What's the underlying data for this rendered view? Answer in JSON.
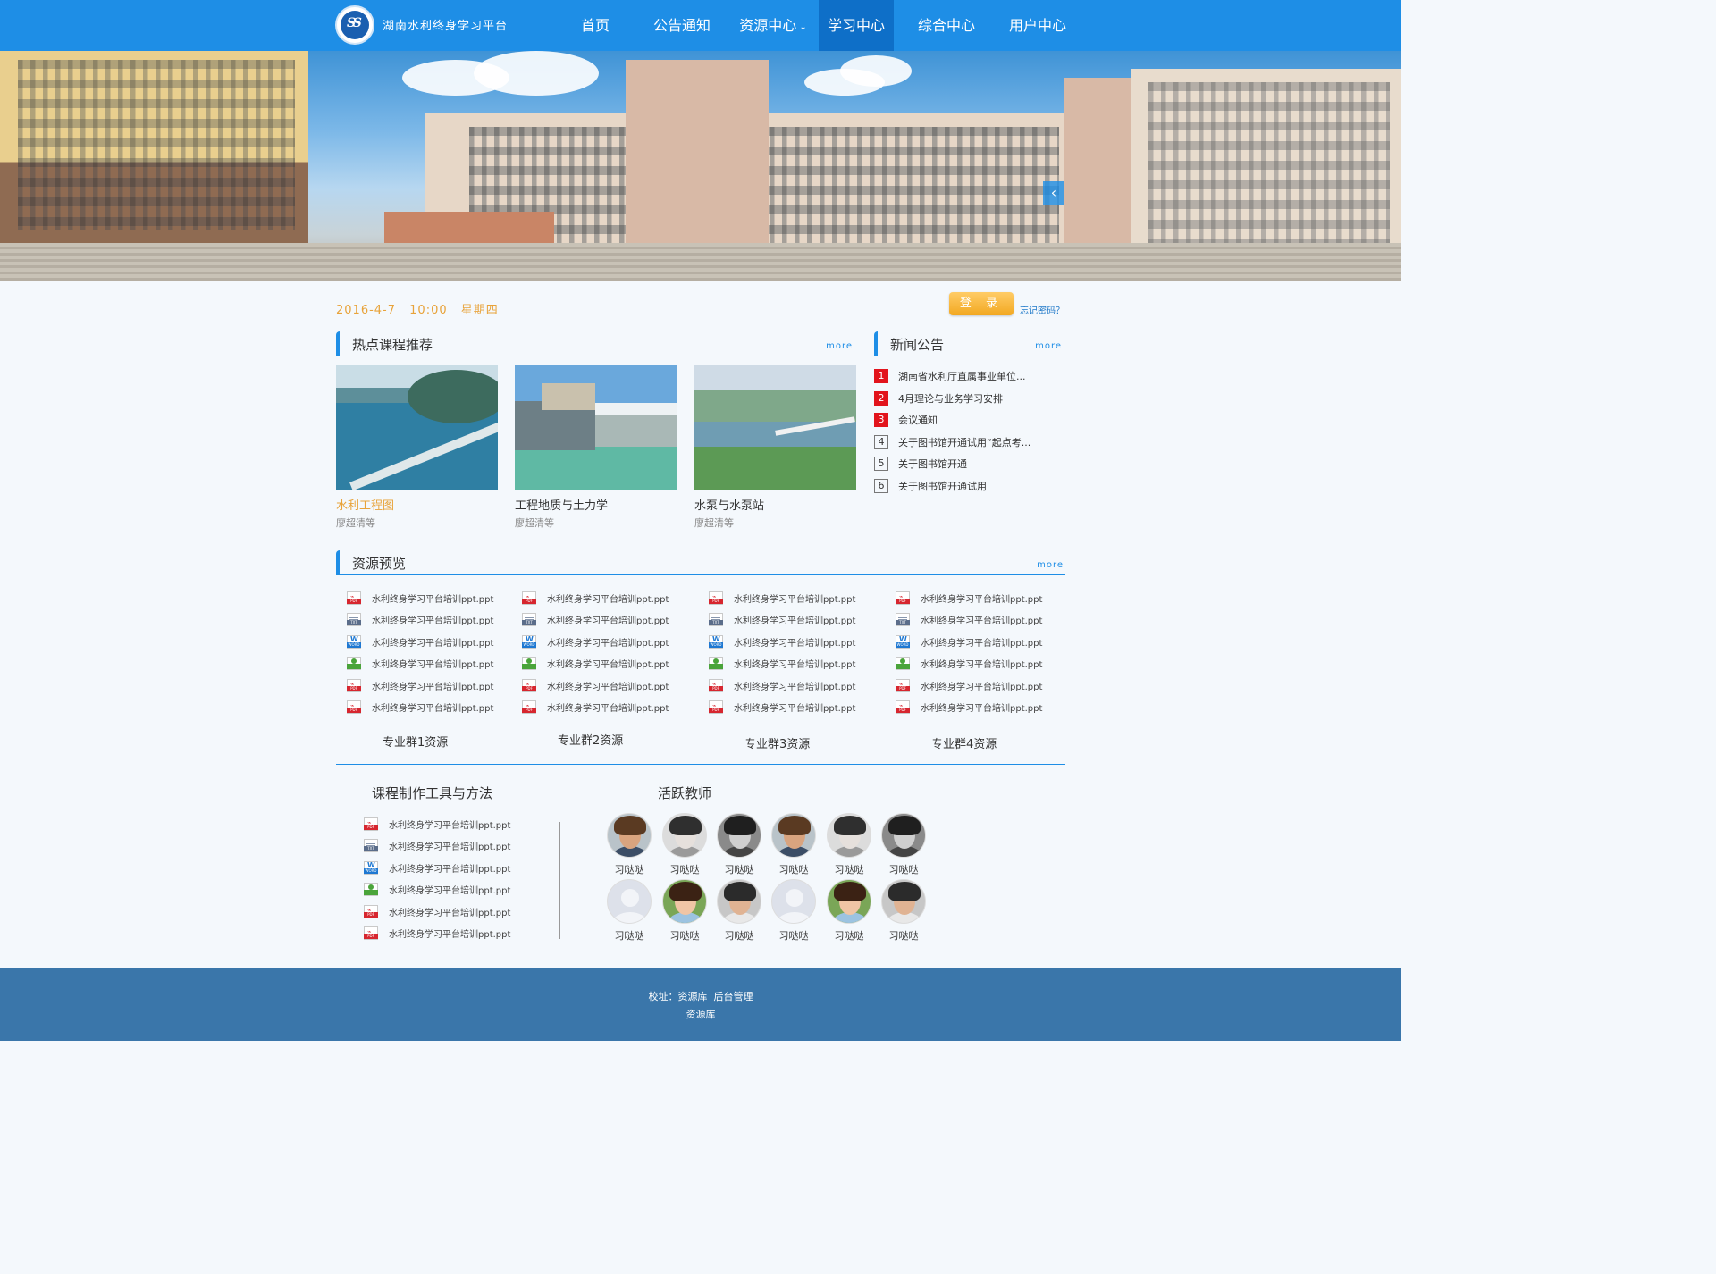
{
  "header": {
    "site_title": "湖南水利终身学习平台",
    "logo_glyph": "SS",
    "nav": [
      {
        "label": "首页",
        "active": false,
        "dropdown": false
      },
      {
        "label": "公告通知",
        "active": false,
        "dropdown": false
      },
      {
        "label": "资源中心",
        "active": false,
        "dropdown": true
      },
      {
        "label": "学习中心",
        "active": true,
        "dropdown": false
      },
      {
        "label": "综合中心",
        "active": false,
        "dropdown": false
      },
      {
        "label": "用户中心",
        "active": false,
        "dropdown": false
      }
    ]
  },
  "banner": {
    "arrow_glyph": "‹"
  },
  "info_bar": {
    "date": "2016-4-7",
    "time": "10:00",
    "weekday": "星期四",
    "login_label": "登 录",
    "forgot_label": "忘记密码？"
  },
  "hot_courses": {
    "title": "热点课程推荐",
    "more": "more",
    "items": [
      {
        "title": "水利工程图",
        "author": "廖超清等",
        "highlight": true
      },
      {
        "title": "工程地质与土力学",
        "author": "廖超清等",
        "highlight": false
      },
      {
        "title": "水泵与水泵站",
        "author": "廖超清等",
        "highlight": false
      }
    ]
  },
  "news": {
    "title": "新闻公告",
    "more": "more",
    "items": [
      {
        "num": "1",
        "text": "湖南省水利厅直属事业单位...",
        "red": true
      },
      {
        "num": "2",
        "text": "4月理论与业务学习安排",
        "red": true
      },
      {
        "num": "3",
        "text": "会议通知",
        "red": true
      },
      {
        "num": "4",
        "text": "关于图书馆开通试用“起点考...",
        "red": false
      },
      {
        "num": "5",
        "text": "关于图书馆开通",
        "red": false
      },
      {
        "num": "6",
        "text": "关于图书馆开通试用",
        "red": false
      }
    ]
  },
  "resources": {
    "title": "资源预览",
    "more": "more",
    "file_types": [
      "pdf",
      "txt",
      "doc",
      "img",
      "pdf",
      "pdf"
    ],
    "file_type_badges": {
      "pdf": "PDF",
      "txt": "TXT",
      "doc": "WORD",
      "img": ""
    },
    "file_name": "水利终身学习平台培训ppt.ppt",
    "groups": [
      "专业群1资源",
      "专业群2资源",
      "专业群3资源",
      "专业群4资源"
    ]
  },
  "tools": {
    "title": "课程制作工具与方法",
    "file_types": [
      "pdf",
      "txt",
      "doc",
      "img",
      "pdf",
      "pdf"
    ],
    "file_name": "水利终身学习平台培训ppt.ppt"
  },
  "teachers": {
    "title": "活跃教师",
    "row1": [
      {
        "name": "习哒哒",
        "style": "m1"
      },
      {
        "name": "习哒哒",
        "style": "f1"
      },
      {
        "name": "习哒哒",
        "style": "m2"
      },
      {
        "name": "习哒哒",
        "style": "m1"
      },
      {
        "name": "习哒哒",
        "style": "f1"
      },
      {
        "name": "习哒哒",
        "style": "m2"
      }
    ],
    "row2": [
      {
        "name": "习哒哒",
        "style": "blank"
      },
      {
        "name": "习哒哒",
        "style": "f2"
      },
      {
        "name": "习哒哒",
        "style": "m3"
      },
      {
        "name": "习哒哒",
        "style": "blank"
      },
      {
        "name": "习哒哒",
        "style": "f2"
      },
      {
        "name": "习哒哒",
        "style": "m3"
      }
    ]
  },
  "footer": {
    "address_label": "校址：",
    "link1": "资源库",
    "link2": "后台管理",
    "link3": "资源库"
  },
  "colors": {
    "primary": "#1e8ee6",
    "accent_orange": "#e8a33a",
    "footer": "#3a76aa",
    "news_red": "#e2141c"
  }
}
